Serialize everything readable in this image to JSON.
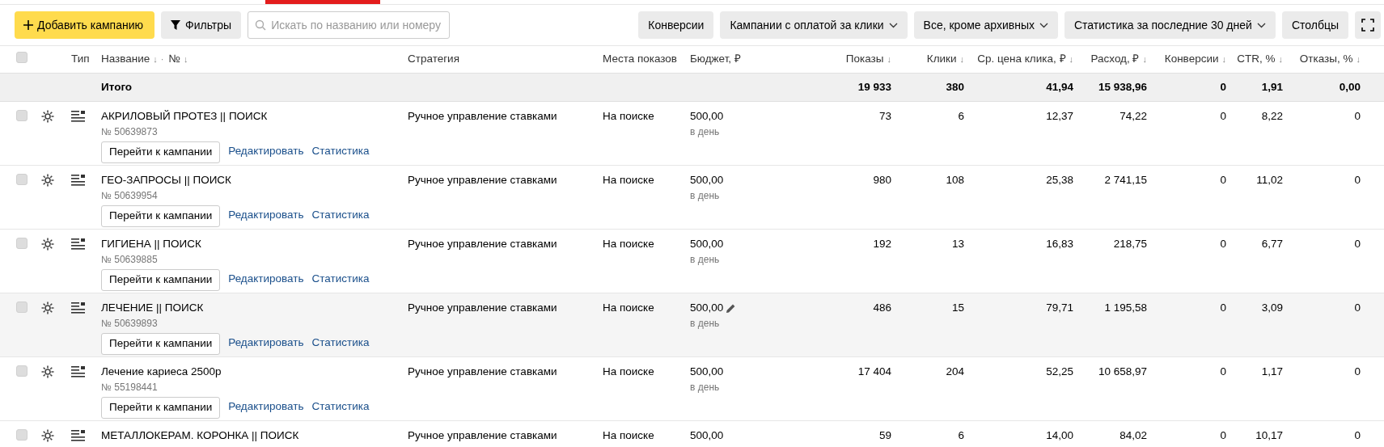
{
  "toolbar": {
    "add_button": "Добавить кампанию",
    "filters_button": "Фильтры",
    "search": {
      "placeholder": "Искать по названию или номеру"
    },
    "right_buttons": [
      {
        "label": "Конверсии",
        "dropdown": false
      },
      {
        "label": "Кампании с оплатой за клики",
        "dropdown": true
      },
      {
        "label": "Все, кроме архивных",
        "dropdown": true
      },
      {
        "label": "Статистика за последние 30 дней",
        "dropdown": true
      },
      {
        "label": "Столбцы",
        "dropdown": false
      }
    ]
  },
  "table": {
    "select_all": {
      "checked": false
    },
    "columns": [
      {
        "label": "Тип"
      },
      {
        "label": "Название",
        "sort_arrow": "↓",
        "separator": "·",
        "label_2": "№",
        "sort_arrow_2": "↓"
      },
      {
        "label": "Стратегия"
      },
      {
        "label": "Места показов"
      },
      {
        "label": "Бюджет, ₽"
      },
      {
        "label": "Показы",
        "sort_arrow": "↓"
      },
      {
        "label": "Клики",
        "sort_arrow": "↓"
      },
      {
        "label": "Ср. цена клика, ₽",
        "sort_arrow": "↓"
      },
      {
        "label": "Расход, ₽",
        "sort_arrow": "↓"
      },
      {
        "label": "Конверсии",
        "sort_arrow": "↓"
      },
      {
        "label": "CTR, %",
        "sort_arrow": "↓"
      },
      {
        "label": "Отказы, %",
        "sort_arrow": "↓"
      }
    ],
    "total": {
      "label": "Итого",
      "values": [
        "19 933",
        "380",
        "41,94",
        "15 938,96",
        "0",
        "1,91",
        "0,00"
      ]
    },
    "rows": [
      {
        "checked": false,
        "hovered": false,
        "name": "АКРИЛОВЫЙ ПРОТЕЗ || ПОИСК",
        "number": "№ 50639873",
        "actions": [
          "Перейти к кампании",
          "Редактировать",
          "Статистика"
        ],
        "strategy": "Ручное управление ставками",
        "places": "На поиске",
        "budget": "500,00",
        "budget_period": "в день",
        "values": [
          "73",
          "6",
          "12,37",
          "74,22",
          "0",
          "8,22",
          "0"
        ]
      },
      {
        "checked": false,
        "hovered": false,
        "name": "ГЕО-ЗАПРОСЫ || ПОИСК",
        "number": "№ 50639954",
        "actions": [
          "Перейти к кампании",
          "Редактировать",
          "Статистика"
        ],
        "strategy": "Ручное управление ставками",
        "places": "На поиске",
        "budget": "500,00",
        "budget_period": "в день",
        "values": [
          "980",
          "108",
          "25,38",
          "2 741,15",
          "0",
          "11,02",
          "0"
        ]
      },
      {
        "checked": false,
        "hovered": false,
        "name": "ГИГИЕНА || ПОИСК",
        "number": "№ 50639885",
        "actions": [
          "Перейти к кампании",
          "Редактировать",
          "Статистика"
        ],
        "strategy": "Ручное управление ставками",
        "places": "На поиске",
        "budget": "500,00",
        "budget_period": "в день",
        "values": [
          "192",
          "13",
          "16,83",
          "218,75",
          "0",
          "6,77",
          "0"
        ]
      },
      {
        "checked": false,
        "hovered": true,
        "name": "ЛЕЧЕНИЕ || ПОИСК",
        "number": "№ 50639893",
        "actions": [
          "Перейти к кампании",
          "Редактировать",
          "Статистика"
        ],
        "strategy": "Ручное управление ставками",
        "places": "На поиске",
        "budget": "500,00",
        "budget_period": "в день",
        "values": [
          "486",
          "15",
          "79,71",
          "1 195,58",
          "0",
          "3,09",
          "0"
        ]
      },
      {
        "checked": false,
        "hovered": false,
        "name": "Лечение кариеса 2500р",
        "number": "№ 55198441",
        "actions": [
          "Перейти к кампании",
          "Редактировать",
          "Статистика"
        ],
        "strategy": "Ручное управление ставками",
        "places": "На поиске",
        "budget": "500,00",
        "budget_period": "в день",
        "values": [
          "17 404",
          "204",
          "52,25",
          "10 658,97",
          "0",
          "1,17",
          "0"
        ]
      },
      {
        "checked": false,
        "hovered": false,
        "name": "МЕТАЛЛОКЕРАМ. КОРОНКА || ПОИСК",
        "strategy": "Ручное управление ставками",
        "places": "На поиске",
        "budget": "500,00",
        "values": [
          "59",
          "6",
          "14,00",
          "84,02",
          "0",
          "10,17",
          "0"
        ]
      }
    ]
  }
}
